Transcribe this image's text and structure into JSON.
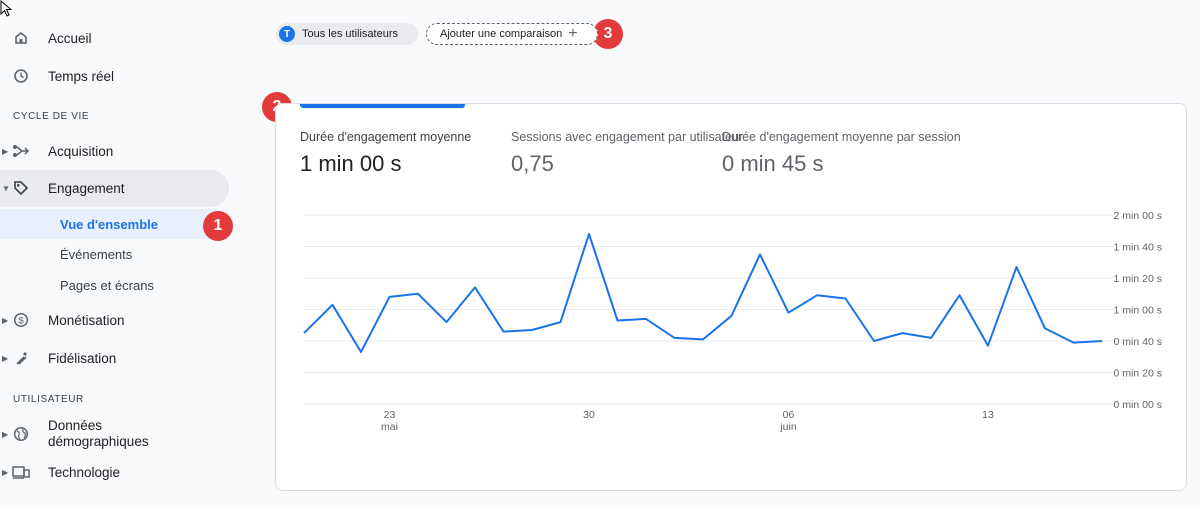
{
  "sidebar": {
    "home": "Accueil",
    "realtime": "Temps réel",
    "lifecycle_header": "CYCLE DE VIE",
    "acquisition": "Acquisition",
    "engagement": "Engagement",
    "engagement_children": [
      "Vue d'ensemble",
      "Événements",
      "Pages et écrans"
    ],
    "monetization": "Monétisation",
    "retention": "Fidélisation",
    "user_header": "UTILISATEUR",
    "demographics_line1": "Données",
    "demographics_line2": "démographiques",
    "technology": "Technologie"
  },
  "comparison_bar": {
    "users_avatar": "T",
    "users_chip": "Tous les utilisateurs",
    "add_comparison": "Ajouter une comparaison",
    "plus": "+"
  },
  "badges": [
    "1",
    "2",
    "3"
  ],
  "metrics": [
    {
      "label": "Durée d'engagement moyenne",
      "value": "1 min 00 s"
    },
    {
      "label": "Sessions avec engagement par utilisateur",
      "value": "0,75"
    },
    {
      "label": "Durée d'engagement moyenne par session",
      "value": "0 min 45 s"
    }
  ],
  "chart_data": {
    "type": "line",
    "y_unit": "seconds",
    "ylim": [
      0,
      120
    ],
    "y_tick_labels": [
      "2 min 00 s",
      "1 min 40 s",
      "1 min 20 s",
      "1 min 00 s",
      "0 min 40 s",
      "0 min 20 s",
      "0 min 00 s"
    ],
    "y_tick_values": [
      120,
      100,
      80,
      60,
      40,
      20,
      0
    ],
    "x_tick_labels": [
      {
        "day": "23",
        "month": "mai"
      },
      {
        "day": "30",
        "month": ""
      },
      {
        "day": "06",
        "month": "juin"
      },
      {
        "day": "13",
        "month": ""
      }
    ],
    "x_tick_dates": [
      "2023-05-23",
      "2023-05-30",
      "2023-06-06",
      "2023-06-13"
    ],
    "dates": [
      "2023-05-20",
      "2023-05-21",
      "2023-05-22",
      "2023-05-23",
      "2023-05-24",
      "2023-05-25",
      "2023-05-26",
      "2023-05-27",
      "2023-05-28",
      "2023-05-29",
      "2023-05-30",
      "2023-05-31",
      "2023-06-01",
      "2023-06-02",
      "2023-06-03",
      "2023-06-04",
      "2023-06-05",
      "2023-06-06",
      "2023-06-07",
      "2023-06-08",
      "2023-06-09",
      "2023-06-10",
      "2023-06-11",
      "2023-06-12",
      "2023-06-13",
      "2023-06-14",
      "2023-06-15",
      "2023-06-16",
      "2023-06-17"
    ],
    "series": [
      {
        "values": [
          45,
          63,
          33,
          68,
          70,
          52,
          74,
          46,
          47,
          52,
          108,
          53,
          54,
          42,
          41,
          56,
          95,
          58,
          69,
          67,
          40,
          45,
          42,
          69,
          37,
          87,
          48,
          39,
          40
        ],
        "color": "#1a73e8"
      }
    ]
  }
}
